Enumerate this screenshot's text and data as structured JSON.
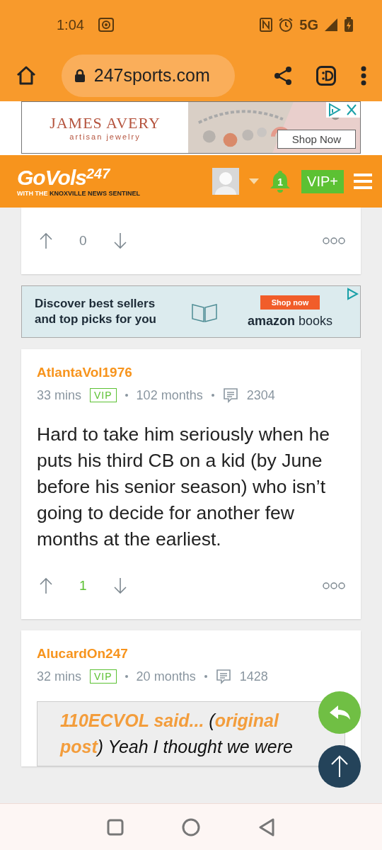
{
  "status_bar": {
    "time": "1:04",
    "network": "5G"
  },
  "browser": {
    "url": "247sports.com"
  },
  "top_ad": {
    "brand": "JAMES AVERY",
    "tagline": "artisan jewelry",
    "button": "Shop Now"
  },
  "site_header": {
    "logo": "GoVols",
    "logo_sup": "247",
    "subtitle_prefix": "WITH THE",
    "subtitle": "KNOXVILLE NEWS SENTINEL",
    "notifications": "1",
    "vip_button": "VIP+"
  },
  "feed": [
    {
      "kind": "partial_post",
      "votes": "0",
      "positive": false
    },
    {
      "kind": "ad",
      "headline": "Discover best sellers and top picks for you",
      "button": "Shop now",
      "brand": "amazon",
      "brand_suffix": "books"
    },
    {
      "kind": "post",
      "author": "AtlantaVol1976",
      "time": "33 mins",
      "badge": "VIP",
      "tenure": "102 months",
      "comment_count": "2304",
      "body": "Hard to take him seriously when he puts his third CB on a kid (by June before his senior season) who isn’t going to decide for another few months at the earliest.",
      "votes": "1",
      "positive": true
    },
    {
      "kind": "post",
      "author": "AlucardOn247",
      "time": "32 mins",
      "badge": "VIP",
      "tenure": "20 months",
      "comment_count": "1428",
      "quote": "**110ECVOL said...** (**original post**) Yeah I thought we were"
    }
  ]
}
